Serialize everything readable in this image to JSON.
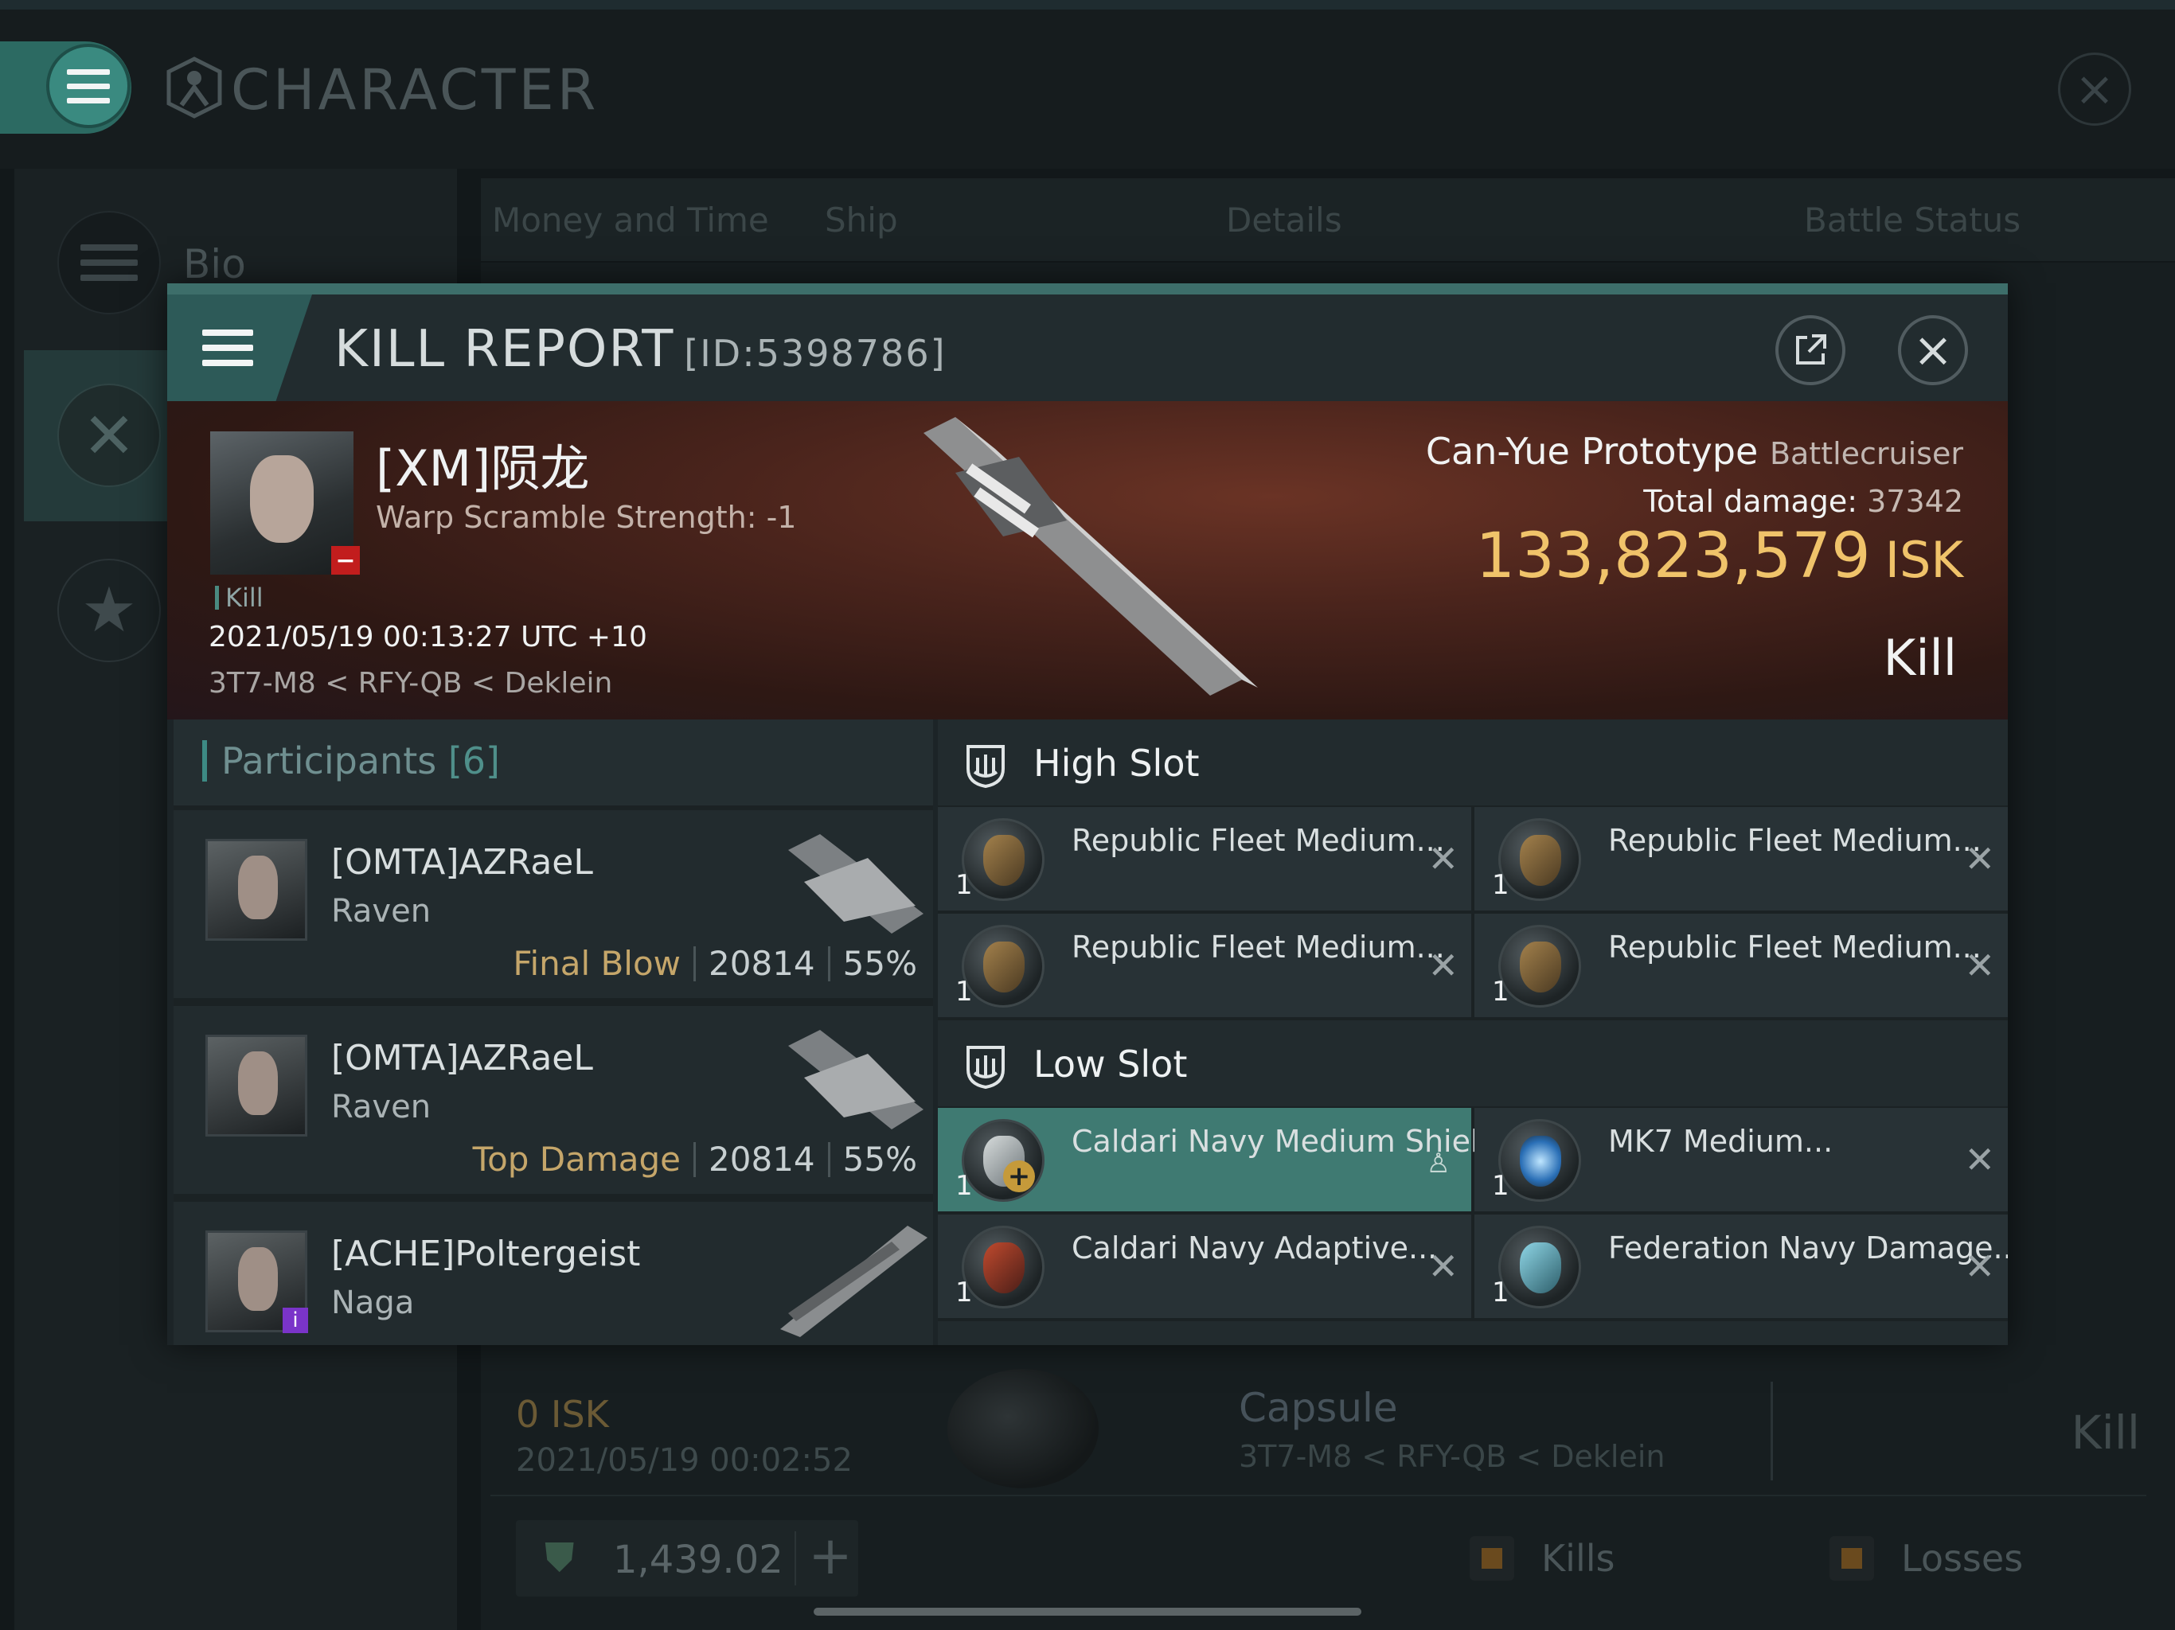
{
  "app": {
    "title": "CHARACTER",
    "sidebar": [
      {
        "label": "Bio"
      }
    ],
    "tabs": [
      "Money and Time",
      "Ship",
      "Details",
      "Battle Status"
    ]
  },
  "modal": {
    "title": "KILL REPORT",
    "id": "[ID:5398786]"
  },
  "victim": {
    "name": "[XM]陨龙",
    "subtitle": "Warp Scramble Strength: -1",
    "tag": "Kill",
    "time": "2021/05/19 00:13:27 UTC +10",
    "location": "3T7-M8 < RFY-QB < Deklein",
    "ship": "Can-Yue Prototype",
    "ship_class": "Battlecruiser",
    "total_damage_label": "Total damage:",
    "total_damage": "37342",
    "isk_value": "133,823,579",
    "isk_unit": "ISK",
    "result": "Kill"
  },
  "participants": {
    "title": "Participants",
    "count": "[6]",
    "rows": [
      {
        "name": "[OMTA]AZRaeL",
        "ship": "Raven",
        "role": "Final Blow",
        "damage": "20814",
        "percent": "55%"
      },
      {
        "name": "[OMTA]AZRaeL",
        "ship": "Raven",
        "role": "Top Damage",
        "damage": "20814",
        "percent": "55%"
      },
      {
        "name": "[ACHE]Poltergeist",
        "ship": "Naga"
      }
    ]
  },
  "slots": {
    "high": {
      "title": "High Slot",
      "items": [
        {
          "name": "Republic Fleet Medium...",
          "qty": "1"
        },
        {
          "name": "Republic Fleet Medium...",
          "qty": "1"
        },
        {
          "name": "Republic Fleet Medium...",
          "qty": "1"
        },
        {
          "name": "Republic Fleet Medium...",
          "qty": "1"
        }
      ]
    },
    "low": {
      "title": "Low Slot",
      "items": [
        {
          "name": "Caldari Navy Medium Shield ...",
          "qty": "1"
        },
        {
          "name": "MK7 Medium...",
          "qty": "1"
        },
        {
          "name": "Caldari Navy Adaptive...",
          "qty": "1"
        },
        {
          "name": "Federation Navy Damage...",
          "qty": "1"
        }
      ]
    }
  },
  "background_row": {
    "isk": "0  ISK",
    "date": "2021/05/19  00:02:52",
    "ship": "Capsule",
    "location": "3T7-M8 < RFY-QB < Deklein",
    "result": "Kill"
  },
  "footer": {
    "value": "1,439.02",
    "legend": [
      "Kills",
      "Losses"
    ]
  },
  "colors": {
    "accent": "#3d8a84",
    "isk_gold": "#f0c36a",
    "selected_slot": "#3f7a72",
    "victim_badge": "#c21d1d"
  }
}
